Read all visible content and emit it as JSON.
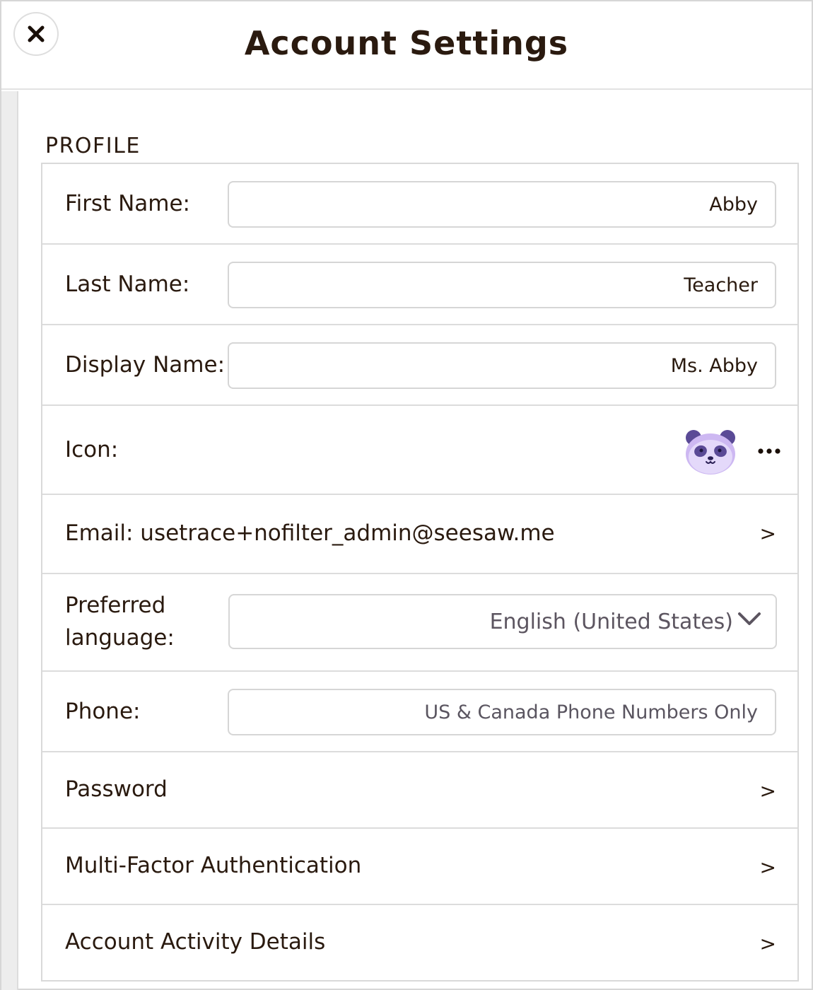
{
  "header": {
    "title": "Account Settings",
    "close_icon": "close-icon"
  },
  "profile": {
    "section_label": "PROFILE",
    "first_name": {
      "label": "First Name:",
      "value": "Abby"
    },
    "last_name": {
      "label": "Last Name:",
      "value": "Teacher"
    },
    "display_name": {
      "label": "Display Name:",
      "value": "Ms. Abby"
    },
    "icon": {
      "label": "Icon:",
      "avatar": "panda-icon",
      "more": "more-horizontal-icon"
    },
    "email": {
      "text": "Email: usetrace+nofilter_admin@seesaw.me",
      "chevron": ">"
    },
    "language": {
      "label_line1": "Preferred",
      "label_line2": "language:",
      "value": "English (United States)"
    },
    "phone": {
      "label": "Phone:",
      "value": "",
      "placeholder": "US & Canada Phone Numbers Only"
    },
    "password": {
      "label": "Password",
      "chevron": ">"
    },
    "mfa": {
      "label": "Multi-Factor Authentication",
      "chevron": ">"
    },
    "activity": {
      "label": "Account Activity Details",
      "chevron": ">"
    }
  },
  "colors": {
    "text": "#2a1a0f",
    "border": "#d6d6d6",
    "rail": "#ededed",
    "panda": "#c9b3f0"
  }
}
